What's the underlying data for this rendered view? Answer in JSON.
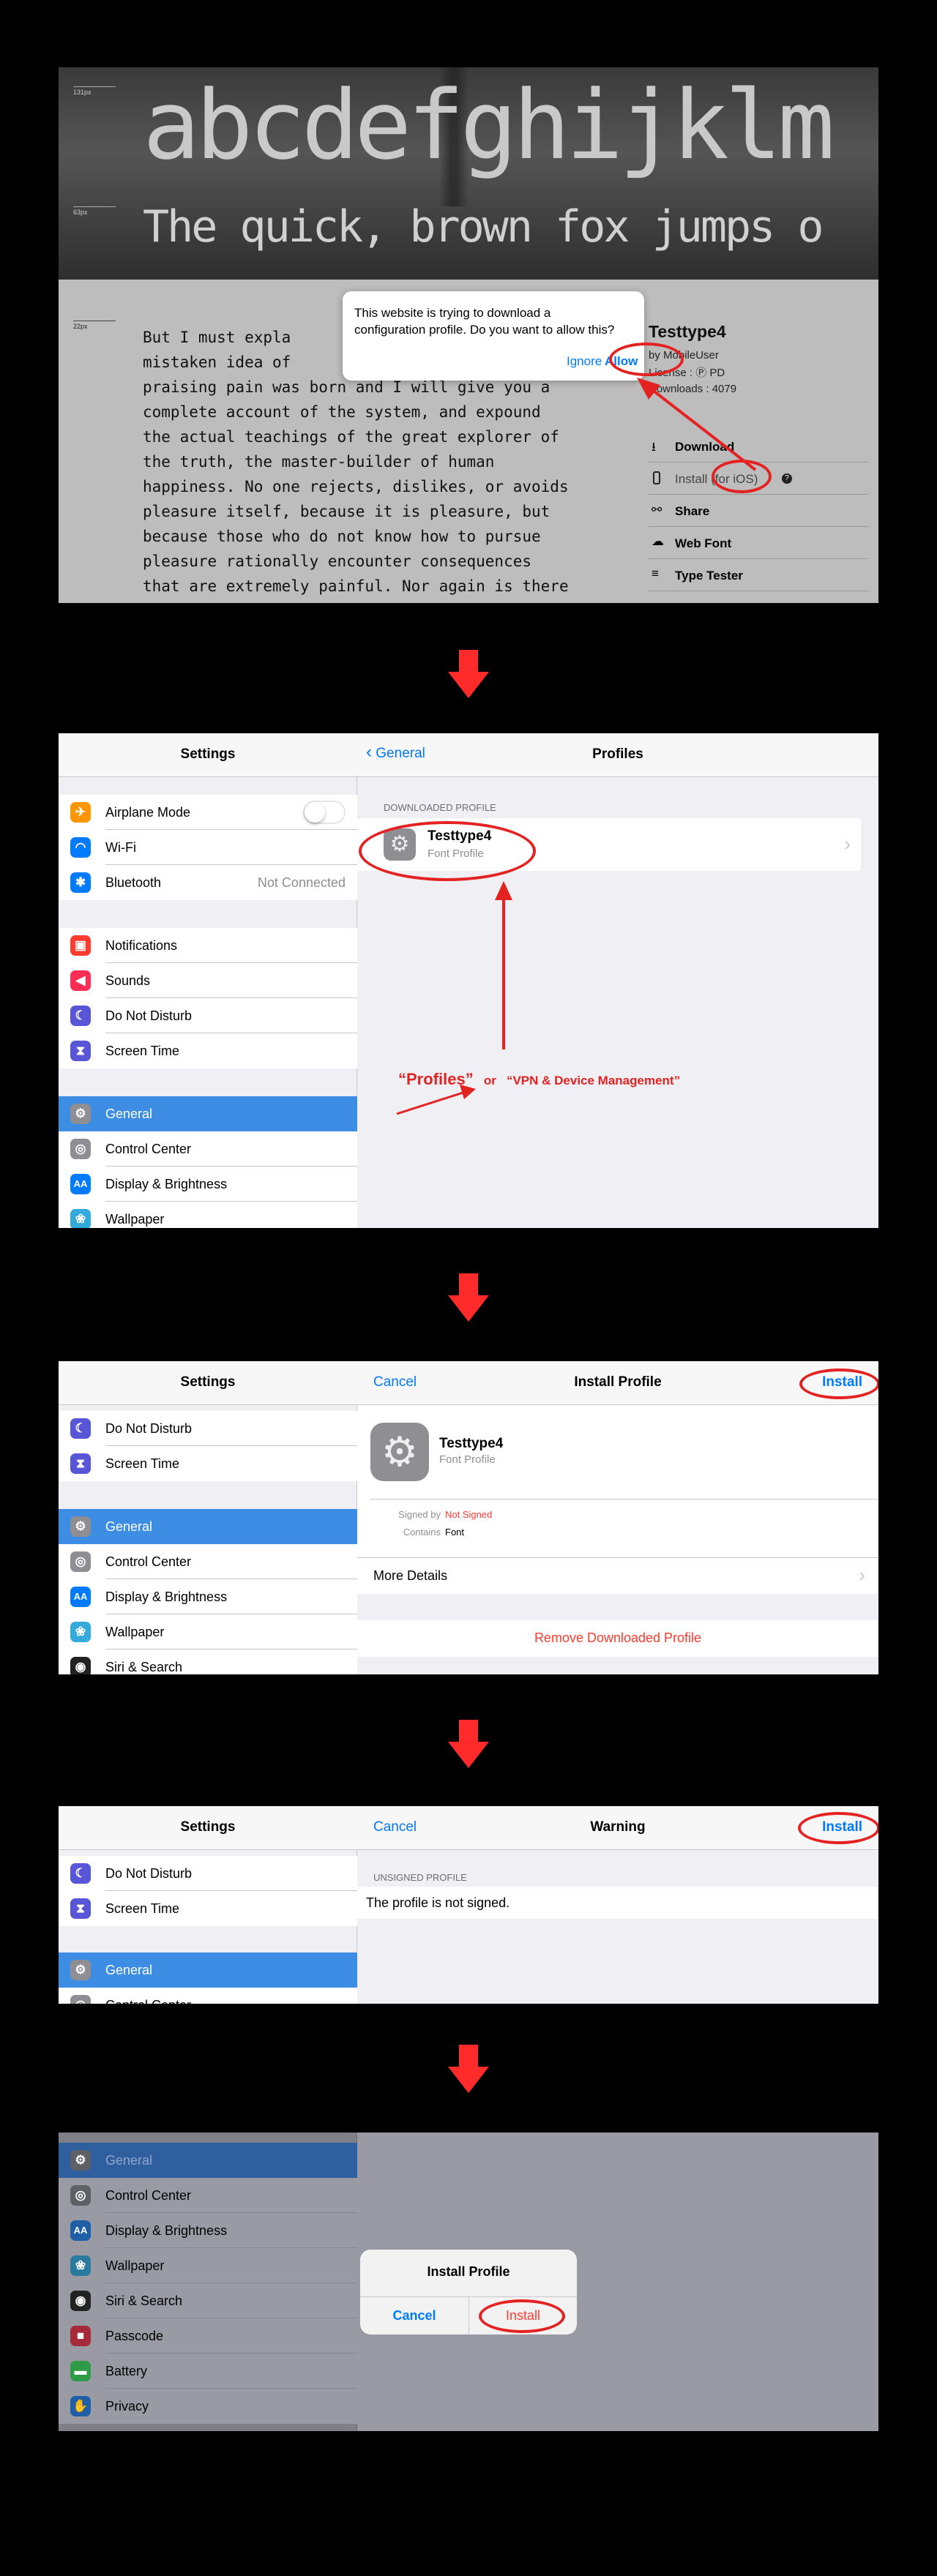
{
  "web": {
    "specimen_large": "abcdefghijklm",
    "specimen_medium": "The quick, brown fox jumps o",
    "size_labels": [
      "131px",
      "63px",
      "22px"
    ],
    "body_lines": [
      "But I must expla",
      "mistaken idea of",
      "praising pain was born and I will give you a",
      "complete account of the system, and expound",
      "the actual teachings of the great explorer of",
      "the truth, the master-builder of human",
      "happiness. No one rejects, dislikes, or avoids",
      "pleasure itself, because it is pleasure, but",
      "because those who do not know how to pursue",
      "pleasure rationally encounter consequences",
      "that are extremely painful. Nor again is there"
    ],
    "font_name": "Testtype4",
    "author": "by MobileUser",
    "license": "License : Ⓟ PD",
    "downloads": "Downloads : 4079",
    "menu": [
      "Download",
      "Install (for iOS)",
      "Share",
      "Web Font",
      "Type Tester"
    ],
    "dialog_text": "This website is trying to download a configuration profile. Do you want to allow this?",
    "ignore": "Ignore",
    "allow": "Allow"
  },
  "s2": {
    "settings_title": "Settings",
    "back_label": "General",
    "nav_title": "Profiles",
    "airplane": "Airplane Mode",
    "wifi": "Wi-Fi",
    "bluetooth": "Bluetooth",
    "bluetooth_value": "Not Connected",
    "notifications": "Notifications",
    "sounds": "Sounds",
    "dnd": "Do Not Disturb",
    "screen_time": "Screen Time",
    "general": "General",
    "control_center": "Control Center",
    "display": "Display & Brightness",
    "wallpaper": "Wallpaper",
    "section_header": "DOWNLOADED PROFILE",
    "profile_name": "Testtype4",
    "profile_sub": "Font Profile",
    "annot_1": "“Profiles”",
    "annot_or": "or",
    "annot_2": "“VPN & Device Management”"
  },
  "s3": {
    "settings_title": "Settings",
    "dnd": "Do Not Disturb",
    "screen_time": "Screen Time",
    "general": "General",
    "control_center": "Control Center",
    "display": "Display & Brightness",
    "wallpaper": "Wallpaper",
    "siri": "Siri & Search",
    "cancel": "Cancel",
    "nav_title": "Install Profile",
    "install": "Install",
    "profile_name": "Testtype4",
    "profile_sub": "Font Profile",
    "signed_by_label": "Signed by",
    "signed_by_value": "Not Signed",
    "contains_label": "Contains",
    "contains_value": "Font",
    "more_details": "More Details",
    "remove": "Remove Downloaded Profile"
  },
  "s4": {
    "settings_title": "Settings",
    "dnd": "Do Not Disturb",
    "screen_time": "Screen Time",
    "general": "General",
    "control_center": "Control Center",
    "cancel": "Cancel",
    "nav_title": "Warning",
    "install": "Install",
    "section_header": "UNSIGNED PROFILE",
    "message": "The profile is not signed."
  },
  "s5": {
    "general": "General",
    "control_center": "Control Center",
    "display": "Display & Brightness",
    "wallpaper": "Wallpaper",
    "siri": "Siri & Search",
    "passcode": "Passcode",
    "battery": "Battery",
    "privacy": "Privacy",
    "alert_title": "Install Profile",
    "cancel": "Cancel",
    "install": "Install"
  },
  "colors": {
    "accent_blue": "#007aff",
    "selection_blue": "#3d8de5",
    "annotation_red": "#e52222",
    "warning_red": "#ff3b30"
  }
}
